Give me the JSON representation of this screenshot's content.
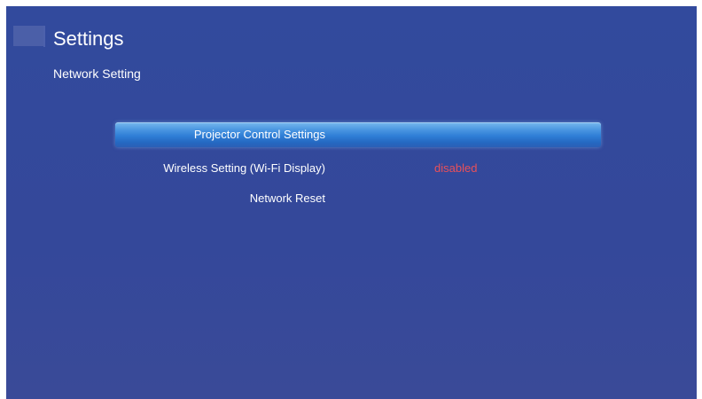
{
  "header": {
    "title": "Settings",
    "subtitle": "Network Setting",
    "icon": "settings-square-icon"
  },
  "menu": {
    "items": [
      {
        "label": "Projector Control Settings",
        "value": "",
        "selected": true
      },
      {
        "label": "Wireless Setting (Wi-Fi Display)",
        "value": "disabled",
        "selected": false
      },
      {
        "label": "Network Reset",
        "value": "",
        "selected": false
      }
    ]
  },
  "colors": {
    "background": "#34489a",
    "highlight": "#2f7ed6",
    "value_disabled": "#e8505a",
    "text": "#ffffff"
  }
}
